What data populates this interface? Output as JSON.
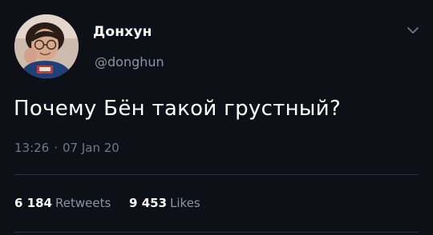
{
  "tweet": {
    "display_name": "Донхун",
    "handle": "@donghun",
    "text": "Почему Бён такой грустный?",
    "time": "13:26",
    "separator": "·",
    "date": "07 Jan 20",
    "retweets": {
      "count": "6 184",
      "label": "Retweets"
    },
    "likes": {
      "count": "9 453",
      "label": "Likes"
    }
  },
  "icons": {
    "avatar": "profile-photo",
    "menu": "chevron-down-icon"
  },
  "colors": {
    "background": "#0d1016",
    "text": "#ffffff",
    "secondary": "#8a95a1",
    "divider": "#2a323c"
  }
}
